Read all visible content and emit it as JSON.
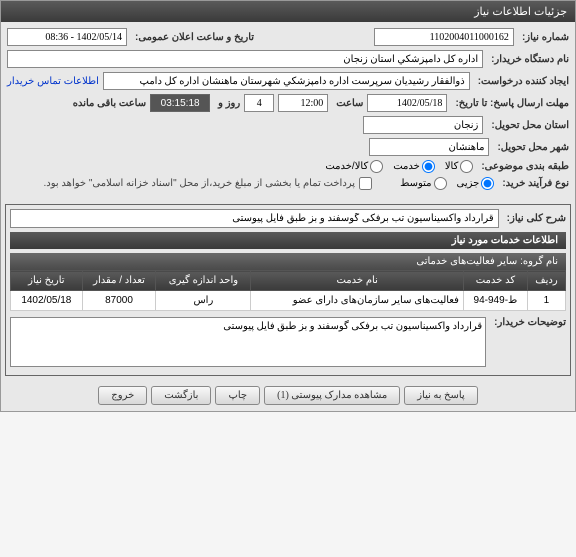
{
  "header": {
    "title": "جزئیات اطلاعات نیاز"
  },
  "form": {
    "need_number_label": "شماره نیاز:",
    "need_number": "1102004011000162",
    "announce_label": "تاریخ و ساعت اعلان عمومی:",
    "announce_value": "1402/05/14 - 08:36",
    "buyer_label": "نام دستگاه خریدار:",
    "buyer_value": "اداره کل دامپزشکي استان زنجان",
    "requester_label": "ایجاد کننده درخواست:",
    "requester_value": "ذوالفقار رشيديان سرپرست اداره دامپزشکي شهرستان ماهنشان اداره کل دامپ",
    "contact_link": "اطلاعات تماس خریدار",
    "deadline_label": "مهلت ارسال پاسخ: تا تاریخ:",
    "deadline_date": "1402/05/18",
    "time_label": "ساعت",
    "deadline_time": "12:00",
    "day_label": "روز و",
    "day_value": "4",
    "remain_time": "03:15:18",
    "remain_label": "ساعت باقی مانده",
    "province_label": "استان محل تحویل:",
    "province_value": "زنجان",
    "city_label": "شهر محل تحویل:",
    "city_value": "ماهنشان",
    "category_label": "طبقه بندی موضوعی:",
    "radio_kala": "کالا",
    "radio_khadmat": "خدمت",
    "radio_kala_khadmat": "کالا/خدمت",
    "process_label": "نوع فرآیند خرید:",
    "radio_jozei": "جزیی",
    "radio_motevaset": "متوسط",
    "checkbox_text": "پرداخت تمام یا بخشی از مبلغ خرید،از محل \"اسناد خزانه اسلامی\" خواهد بود."
  },
  "detail": {
    "sharh_label": "شرح کلی نیاز:",
    "sharh_value": "قرارداد واکسیناسیون تب برفکی گوسفند و بز طبق فایل پیوستی",
    "services_header": "اطلاعات خدمات مورد نیاز",
    "group_label": "نام گروه:",
    "group_value": "سایر فعالیت‌های خدماتی"
  },
  "table": {
    "headers": [
      "ردیف",
      "کد خدمت",
      "نام خدمت",
      "واحد اندازه گیری",
      "تعداد / مقدار",
      "تاریخ نیاز"
    ],
    "row": {
      "idx": "1",
      "code": "ط-949-94",
      "name": "فعالیت‌های سایر سازمان‌های دارای عضو",
      "unit": "راس",
      "qty": "87000",
      "date": "1402/05/18"
    }
  },
  "notes": {
    "label": "توضیحات خریدار:",
    "value": "قرارداد واکسیناسیون تب برفکی گوسفند و بز طبق فایل پیوستی"
  },
  "buttons": {
    "respond": "پاسخ به نیاز",
    "attachments": "مشاهده مدارک پیوستی  (1)",
    "print": "چاپ",
    "back": "بازگشت",
    "exit": "خروج"
  }
}
